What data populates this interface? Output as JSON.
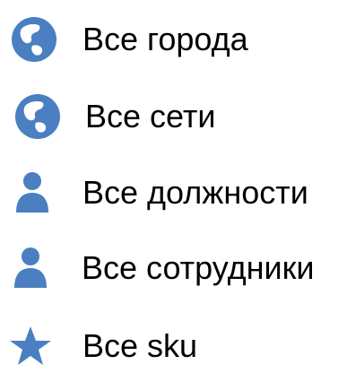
{
  "colors": {
    "icon_blue": "#4a7fc1",
    "text": "#000000",
    "background": "#ffffff"
  },
  "filters": [
    {
      "label": "Все города",
      "icon": "globe-icon"
    },
    {
      "label": "Все сети",
      "icon": "globe-icon"
    },
    {
      "label": "Все должности",
      "icon": "person-icon"
    },
    {
      "label": "Все сотрудники",
      "icon": "person-icon"
    },
    {
      "label": "Все sku",
      "icon": "star-icon"
    }
  ]
}
